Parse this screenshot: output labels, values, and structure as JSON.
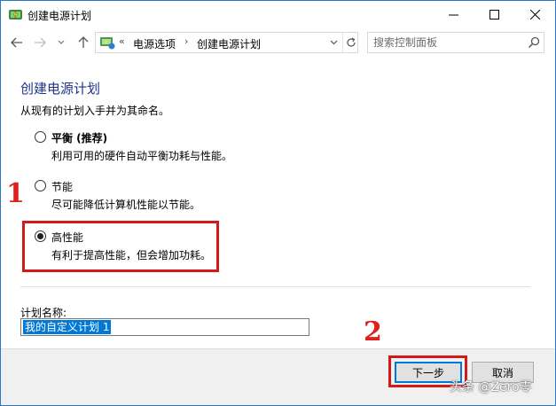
{
  "window": {
    "title": "创建电源计划"
  },
  "address_bar": {
    "overflow": "«",
    "crumbs": [
      "电源选项",
      "创建电源计划"
    ],
    "separator": "›"
  },
  "search": {
    "placeholder": "搜索控制面板"
  },
  "page": {
    "heading": "创建电源计划",
    "subtitle": "从现有的计划入手并为其命名。",
    "options": [
      {
        "label": "平衡 (推荐)",
        "desc": "利用可用的硬件自动平衡功耗与性能。",
        "checked": false
      },
      {
        "label": "节能",
        "desc": "尽可能降低计算机性能以节能。",
        "checked": false
      },
      {
        "label": "高性能",
        "desc": "有利于提高性能，但会增加功耗。",
        "checked": true
      }
    ],
    "plan_name_label": "计划名称:",
    "plan_name_value": "我的自定义计划 1"
  },
  "buttons": {
    "next": "下一步",
    "cancel": "取消"
  },
  "annotations": {
    "step1": "1",
    "step2": "2",
    "highlight_color": "#d11a1a"
  },
  "watermark": "头条 @Zero零",
  "colors": {
    "heading": "#1e3287",
    "selection": "#0078d7",
    "window_border": "#2b78c8"
  }
}
